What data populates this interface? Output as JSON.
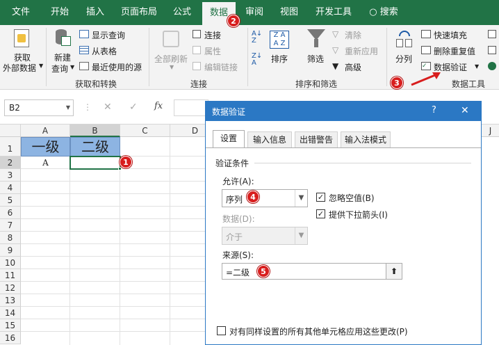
{
  "tabs": {
    "file": "文件",
    "home": "开始",
    "insert": "插入",
    "layout": "页面布局",
    "formulas": "公式",
    "data": "数据",
    "review": "审阅",
    "view": "视图",
    "developer": "开发工具",
    "search": "搜索"
  },
  "ribbon": {
    "get_external_data": [
      "获取",
      "外部数据"
    ],
    "new_query": [
      "新建",
      "查询"
    ],
    "show_queries": "显示查询",
    "from_table": "从表格",
    "recent_sources": "最近使用的源",
    "group_get_transform": "获取和转换",
    "refresh_all": "全部刷新",
    "connections": "连接",
    "properties": "属性",
    "edit_links": "编辑链接",
    "group_connections": "连接",
    "sort": "排序",
    "filter": "筛选",
    "clear": "清除",
    "reapply": "重新应用",
    "advanced": "高级",
    "group_sort_filter": "排序和筛选",
    "split_column": "分列",
    "flash_fill": "快速填充",
    "remove_duplicates": "删除重复值",
    "data_validation": "数据验证",
    "group_data_tools": "数据工具"
  },
  "formula_bar": {
    "name_box": "B2",
    "cancel": "✕",
    "enter": "✓",
    "fx": "fx"
  },
  "sheet": {
    "columns": [
      "A",
      "B",
      "C",
      "D"
    ],
    "rows": [
      "1",
      "2",
      "3",
      "4",
      "5",
      "6",
      "7",
      "8",
      "9",
      "10",
      "11",
      "12",
      "13",
      "14",
      "15",
      "16"
    ],
    "a1": "一级",
    "b1": "二级",
    "a2": "A"
  },
  "dialog": {
    "title": "数据验证",
    "help": "?",
    "close": "✕",
    "tabs": [
      "设置",
      "输入信息",
      "出错警告",
      "输入法模式"
    ],
    "criteria_label": "验证条件",
    "allow_label": "允许(A):",
    "allow_value": "序列",
    "data_label": "数据(D):",
    "data_value": "介于",
    "ignore_blank": "忽略空值(B)",
    "dropdown": "提供下拉箭头(I)",
    "source_label": "来源(S):",
    "source_value": "=二级",
    "apply_all": "对有同样设置的所有其他单元格应用这些更改(P)"
  },
  "badges": [
    "1",
    "2",
    "3",
    "4",
    "5"
  ],
  "colors": {
    "excel_green": "#217346",
    "dialog_blue": "#2b78c4",
    "header_fill": "#8db4e2",
    "badge_red": "#d81e1e"
  }
}
